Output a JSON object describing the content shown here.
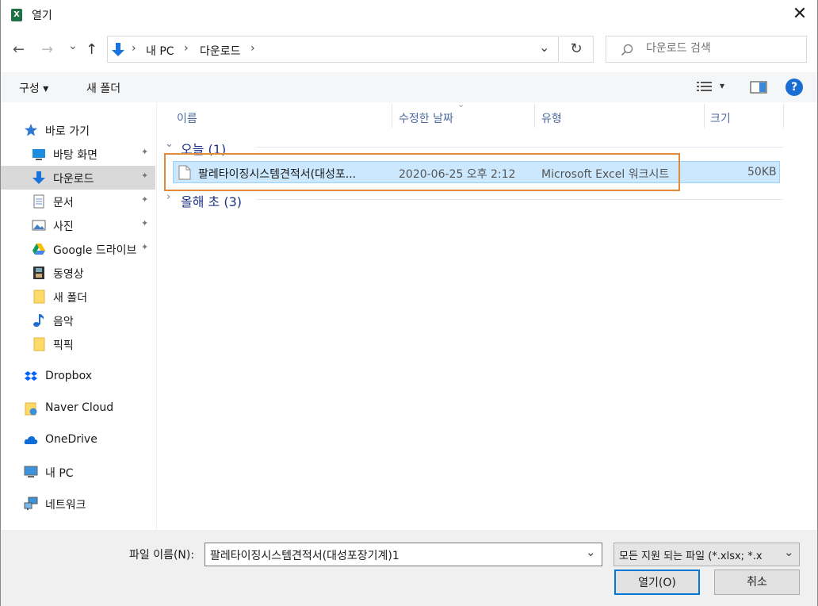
{
  "window": {
    "title": "열기",
    "app_icon_letter": "X",
    "close_glyph": "✕"
  },
  "nav": {
    "back": "←",
    "forward": "→",
    "recent": "⌄",
    "up": "↑",
    "refresh": "↻",
    "dropdown": "⌄"
  },
  "breadcrumb": {
    "sep": "›",
    "items": [
      "내 PC",
      "다운로드"
    ]
  },
  "search": {
    "placeholder": "다운로드 검색"
  },
  "toolbar": {
    "organize": "구성 ▾",
    "new_folder": "새 폴더",
    "view_caret": "▾",
    "help": "?"
  },
  "sidebar": {
    "quick_access": "바로 가기",
    "items": [
      {
        "label": "바탕 화면",
        "pinned": true
      },
      {
        "label": "다운로드",
        "pinned": true
      },
      {
        "label": "문서",
        "pinned": true
      },
      {
        "label": "사진",
        "pinned": true
      },
      {
        "label": "Google 드라이브",
        "pinned": true
      },
      {
        "label": "동영상",
        "pinned": false
      },
      {
        "label": "새 폴더",
        "pinned": false
      },
      {
        "label": "음악",
        "pinned": false
      },
      {
        "label": "픽픽",
        "pinned": false
      }
    ],
    "roots": [
      "Dropbox",
      "Naver Cloud",
      "OneDrive",
      "내 PC",
      "네트워크"
    ],
    "pin_glyph": "📌"
  },
  "columns": {
    "name": "이름",
    "date": "수정한 날짜",
    "type": "유형",
    "size": "크기"
  },
  "groups": [
    {
      "label": "오늘 (1)",
      "expanded": true
    },
    {
      "label": "올해 초 (3)",
      "expanded": false
    }
  ],
  "file": {
    "name": "팔레타이징시스템견적서(대성포...",
    "date": "2020-06-25 오후 2:12",
    "type": "Microsoft Excel 워크시트",
    "size": "50KB"
  },
  "footer": {
    "filename_label": "파일 이름(N):",
    "filename_value": "팔레타이징시스템견적서(대성포장기계)1",
    "filetype": "모든 지원 되는 파일 (*.xlsx; *.x",
    "open_button": "열기(O)",
    "cancel_button": "취소"
  },
  "colors": {
    "selection": "#cce8ff",
    "highlight_box": "#e08a3a",
    "accent": "#0a6fd8",
    "header_text": "#4d6aa1"
  }
}
